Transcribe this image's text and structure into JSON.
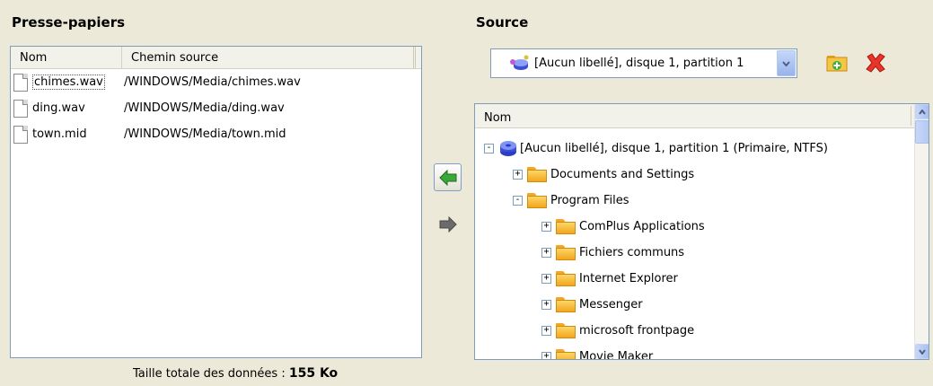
{
  "clipboard": {
    "title": "Presse-papiers",
    "columns": [
      "Nom",
      "Chemin source"
    ],
    "rows": [
      {
        "name": "chimes.wav",
        "path": "/WINDOWS/Media/chimes.wav"
      },
      {
        "name": "ding.wav",
        "path": "/WINDOWS/Media/ding.wav"
      },
      {
        "name": "town.mid",
        "path": "/WINDOWS/Media/town.mid"
      }
    ],
    "total_label": "Taille totale des données :",
    "total_value": "155 Ko"
  },
  "source": {
    "title": "Source",
    "selected": "[Aucun libellé], disque 1, partition 1",
    "tree_header": "Nom",
    "tree": [
      {
        "label": "[Aucun libellé], disque 1, partition 1 (Primaire, NTFS)",
        "level": 0,
        "expander": "-",
        "icon": "disk-icon"
      },
      {
        "label": "Documents and Settings",
        "level": 1,
        "expander": "+",
        "icon": "folder-icon"
      },
      {
        "label": "Program Files",
        "level": 1,
        "expander": "-",
        "icon": "folder-icon"
      },
      {
        "label": "ComPlus Applications",
        "level": 2,
        "expander": "+",
        "icon": "folder-icon"
      },
      {
        "label": "Fichiers communs",
        "level": 2,
        "expander": "+",
        "icon": "folder-icon"
      },
      {
        "label": "Internet Explorer",
        "level": 2,
        "expander": "+",
        "icon": "folder-icon"
      },
      {
        "label": "Messenger",
        "level": 2,
        "expander": "+",
        "icon": "folder-icon"
      },
      {
        "label": "microsoft frontpage",
        "level": 2,
        "expander": "+",
        "icon": "folder-icon"
      },
      {
        "label": "Movie Maker",
        "level": 2,
        "expander": "+",
        "icon": "folder-icon"
      }
    ]
  },
  "icons": {
    "copy_left": "green-arrow-left-icon",
    "copy_right": "gray-arrow-right-icon",
    "add_source": "add-folder-icon",
    "remove_source": "red-x-icon"
  },
  "colors": {
    "window_bg": "#ece9d8",
    "border": "#7f9db9",
    "arrow_green": "#2e9b2e",
    "delete_red": "#e02020"
  }
}
